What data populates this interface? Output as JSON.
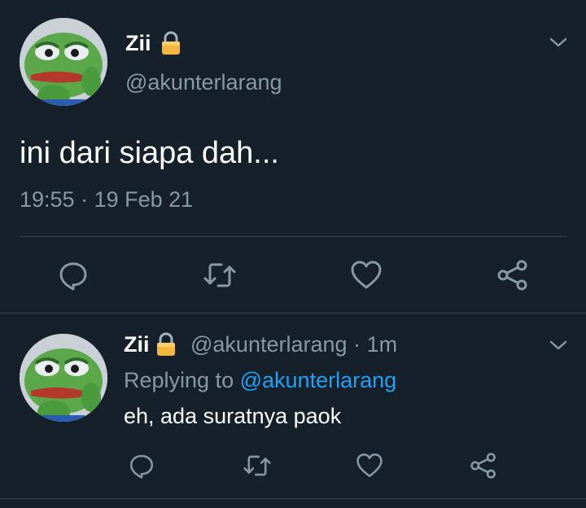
{
  "main_tweet": {
    "user_name": "Zii",
    "handle": "@akunterlarang",
    "text": "ini dari siapa dah...",
    "time": "19:55",
    "separator": "·",
    "date": "19 Feb 21",
    "avatar_icon": "frog-avatar-icon",
    "locked_icon": "lock-icon",
    "menu_icon": "chevron-down-icon"
  },
  "reply": {
    "user_name": "Zii",
    "handle": "@akunterlarang",
    "separator": "·",
    "age": "1m",
    "replying_prefix": "Replying to",
    "replying_to": "@akunterlarang",
    "text": "eh, ada suratnya paok"
  },
  "actions": [
    "reply-icon",
    "retweet-icon",
    "like-icon",
    "share-icon"
  ],
  "colors": {
    "background": "#15202b",
    "text": "#ffffff",
    "muted": "#8899a6",
    "link": "#1da1f2",
    "divider": "#38444d"
  }
}
